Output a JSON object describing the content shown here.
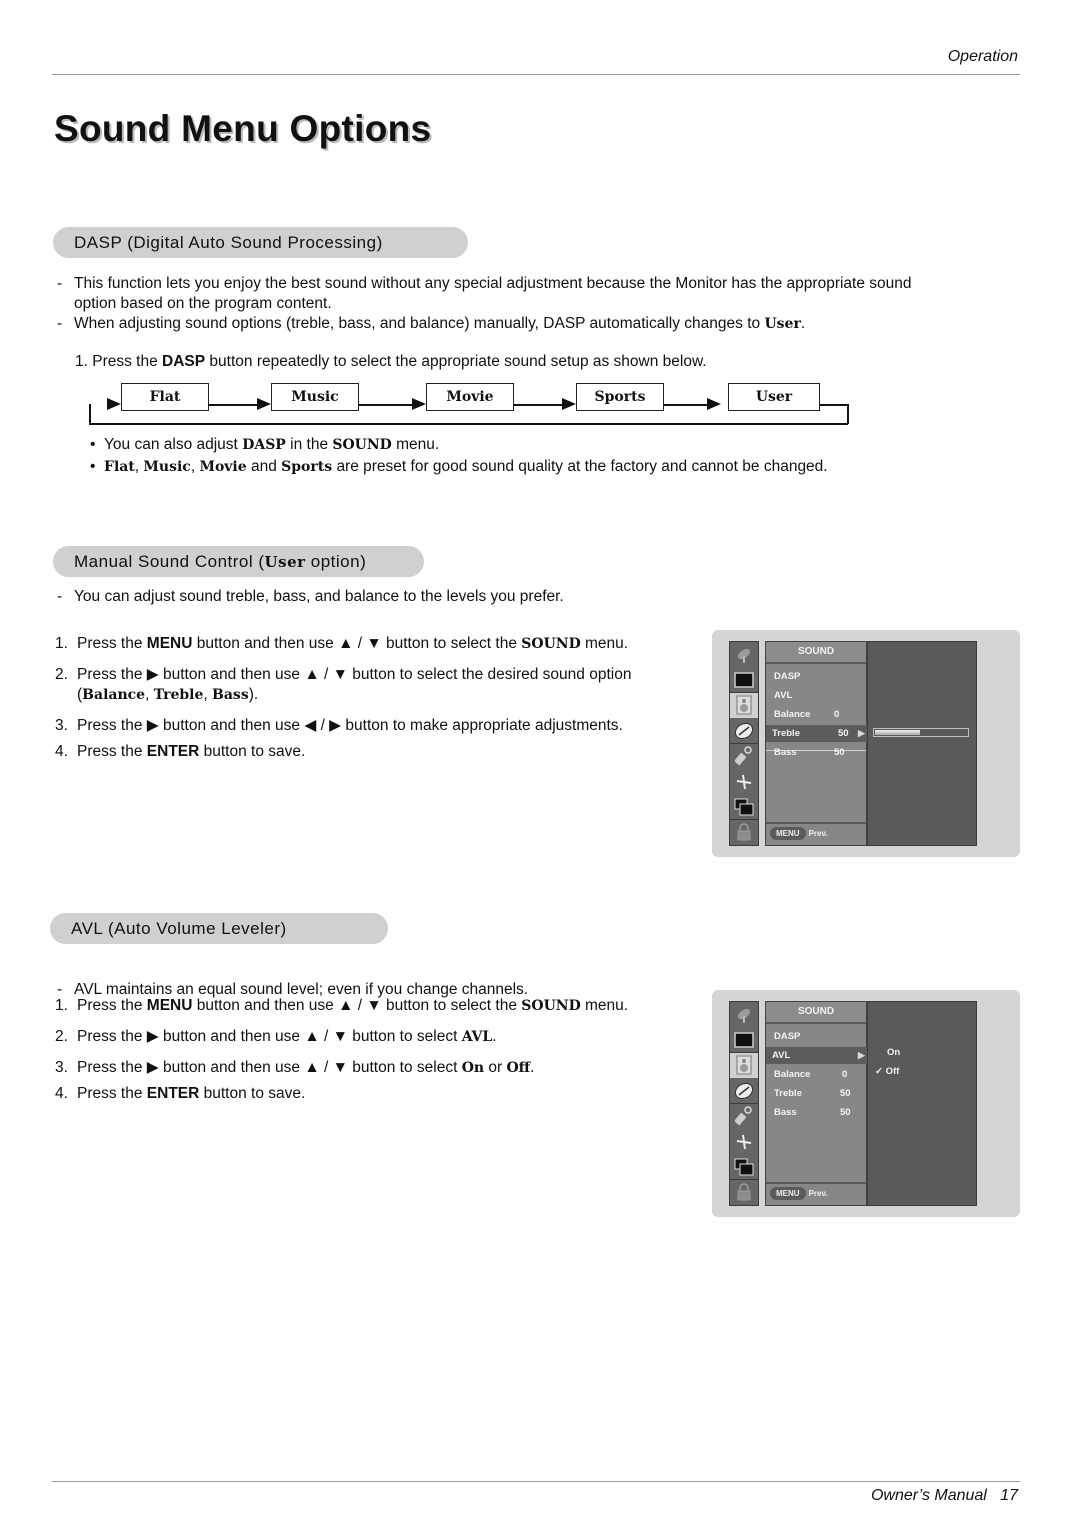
{
  "header": {
    "section_label": "Operation"
  },
  "page_title": "Sound Menu Options",
  "dasp": {
    "heading": "DASP (Digital Auto Sound Processing)",
    "notes": [
      "This function lets you enjoy the best sound without any special adjustment because the Monitor has the appropriate sound option based on the program content.",
      "When adjusting sound options (treble, bass, and balance) manually, DASP automatically changes to"
    ],
    "note2_bold": "User",
    "step1_prefix": "1. Press the",
    "step1_bold": "DASP",
    "step1_suffix": "button repeatedly to select the appropriate sound setup as shown below.",
    "flow": [
      "Flat",
      "Music",
      "Movie",
      "Sports",
      "User"
    ],
    "bullets": {
      "b1": {
        "pre": "You can also adjust",
        "dasp": "DASP",
        "mid": "in the",
        "sound": "SOUND",
        "post": "menu."
      },
      "b2": {
        "flat": "Flat",
        "music": "Music",
        "movie": "Movie",
        "and": "and",
        "sports": "Sports",
        "post": "are preset for good sound quality at the factory and cannot be changed."
      }
    }
  },
  "manual": {
    "heading_pre": "Manual Sound Control (",
    "heading_bold": "User",
    "heading_post": " option)",
    "note": "You can adjust sound treble, bass, and balance to the levels you prefer.",
    "steps": [
      {
        "num": "1.",
        "parts": [
          "Press the ",
          "MENU",
          " button and then use ▲ / ▼  button to select the ",
          "SOUND",
          " menu."
        ]
      },
      {
        "num": "2.",
        "parts": [
          "Press the ▶  button and then use ▲ / ▼ button to select the desired sound option (",
          "Balance",
          ", ",
          "Treble",
          ", ",
          "Bass",
          ")."
        ]
      },
      {
        "num": "3.",
        "text": "Press the ▶  button and then use ◀ / ▶ button to make appropriate adjustments."
      },
      {
        "num": "4.",
        "parts": [
          "Press the ",
          "ENTER",
          " button to save."
        ]
      }
    ]
  },
  "avl": {
    "heading": "AVL (Auto Volume Leveler)",
    "note": "AVL maintains an equal sound level; even if you change channels.",
    "steps": [
      {
        "num": "1.",
        "parts": [
          "Press the ",
          "MENU",
          " button and then use ▲ / ▼  button to select the ",
          "SOUND",
          " menu."
        ]
      },
      {
        "num": "2.",
        "parts": [
          "Press the ▶  button and then use ▲ / ▼ button to select ",
          "AVL",
          "."
        ]
      },
      {
        "num": "3.",
        "parts": [
          "Press the ▶  button and then use ▲ / ▼ button to select ",
          "On",
          " or ",
          "Off",
          "."
        ]
      },
      {
        "num": "4.",
        "parts": [
          "Press the ",
          "ENTER",
          " button to save."
        ]
      }
    ]
  },
  "osd1": {
    "title": "SOUND",
    "items": [
      {
        "label": "DASP",
        "value": ""
      },
      {
        "label": "AVL",
        "value": ""
      },
      {
        "label": "Balance",
        "value": "0"
      },
      {
        "label": "Treble",
        "value": "50"
      },
      {
        "label": "Bass",
        "value": "50"
      }
    ],
    "selected_index": 3,
    "slider_level_percent": 50,
    "footer_button": "MENU",
    "footer_label": "Prev."
  },
  "osd2": {
    "title": "SOUND",
    "items": [
      {
        "label": "DASP",
        "value": ""
      },
      {
        "label": "AVL",
        "value": ""
      },
      {
        "label": "Balance",
        "value": "0"
      },
      {
        "label": "Treble",
        "value": "50"
      },
      {
        "label": "Bass",
        "value": "50"
      }
    ],
    "selected_index": 1,
    "options": [
      {
        "label": "On",
        "checked": false
      },
      {
        "label": "Off",
        "checked": true
      }
    ],
    "check_mark": "✓",
    "footer_button": "MENU",
    "footer_label": "Prev."
  },
  "osd_icons": [
    "satellite-dish-icon",
    "picture-icon",
    "speaker-icon",
    "time-icon",
    "special-key-icon",
    "setup-tools-icon",
    "screen-pip-icon",
    "lock-icon"
  ],
  "footer": {
    "manual_label": "Owner’s Manual",
    "page_number": "17"
  }
}
